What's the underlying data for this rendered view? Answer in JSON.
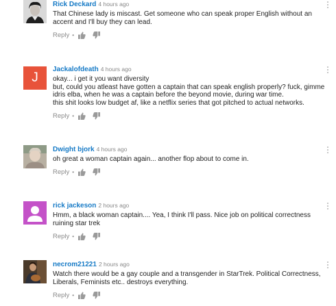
{
  "comments": [
    {
      "author": "Rick Deckard",
      "time": "4 hours ago",
      "lines": [
        "That Chinese lady is miscast. Get someone who can speak proper English without an",
        "accent and I'll buy they can lead."
      ],
      "reply": "Reply",
      "avatar": "person-photo-icon"
    },
    {
      "author": "Jackalofdeath",
      "time": "4 hours ago",
      "avatar_letter": "J",
      "lines": [
        "okay... i get it you want diversity",
        "but, could you atleast have gotten a captain that can speak english properly?  fuck, gimme",
        "idris elba, when he was a captain before the beyond movie, during war time.",
        "this shit looks low budget af, like a netflix series that got pitched to actual networks."
      ],
      "reply": "Reply",
      "avatar_color": "#e8533a"
    },
    {
      "author": "Dwight bjork",
      "time": "4 hours ago",
      "lines": [
        "oh great a woman captain again... another flop about to come in."
      ],
      "reply": "Reply",
      "avatar": "person-photo-icon"
    },
    {
      "author": "rick jackeson",
      "time": "2 hours ago",
      "lines": [
        "Hmm, a black woman captain.... Yea, I think I'll pass. Nice job on political correctness",
        "ruining star trek"
      ],
      "reply": "Reply",
      "avatar": "default-user-icon",
      "avatar_color": "#c452c8"
    },
    {
      "author": "necrom21221",
      "time": "2 hours ago",
      "lines": [
        "Watch there would be a gay couple and a transgender in StarTrek.   Political Correctness,",
        "Liberals, Feminists etc.. destroys everything."
      ],
      "reply": "Reply",
      "avatar": "person-photo-icon"
    }
  ],
  "reply_separator": "•"
}
